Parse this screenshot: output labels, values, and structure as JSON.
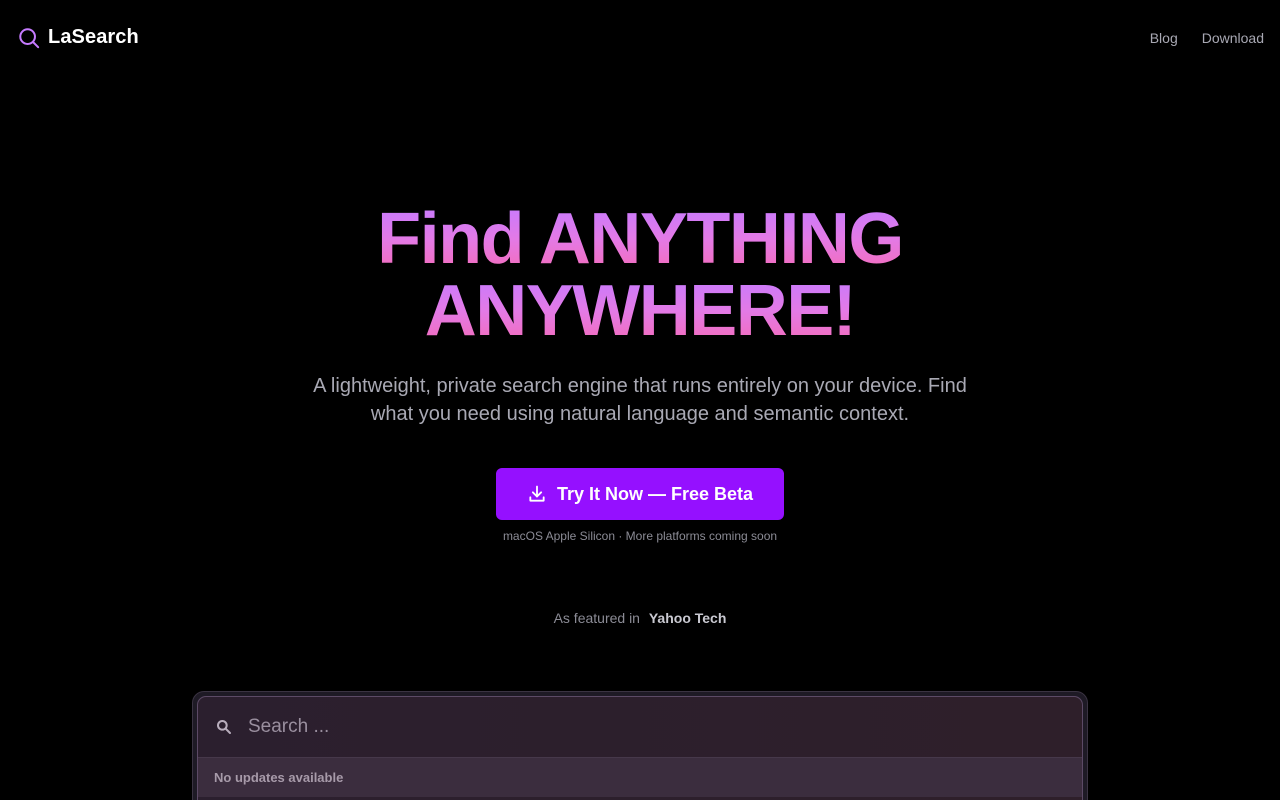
{
  "nav": {
    "brand": "LaSearch",
    "links": [
      {
        "label": "Blog"
      },
      {
        "label": "Download"
      }
    ]
  },
  "hero": {
    "title_line1": "Find ANYTHING",
    "title_line2": "ANYWHERE!",
    "subtitle": "A lightweight, private search engine that runs entirely on your device. Find what you need using natural language and semantic context.",
    "cta_label": "Try It Now — Free Beta",
    "cta_note": "macOS Apple Silicon · More platforms coming soon"
  },
  "featured": {
    "prefix": "As featured in",
    "name": "Yahoo Tech"
  },
  "app_preview": {
    "search_placeholder": "Search ...",
    "status": "No updates available"
  },
  "colors": {
    "accent": "#9510ff",
    "gradient_top": "#c67bff",
    "gradient_bottom": "#f56bb7",
    "background": "#000000"
  },
  "icons": {
    "brand": "search-icon",
    "cta": "download-icon",
    "search": "search-icon"
  }
}
